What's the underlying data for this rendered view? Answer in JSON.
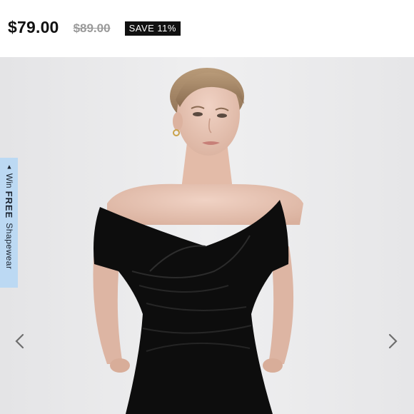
{
  "price": {
    "current": "$79.00",
    "original": "$89.00",
    "save_badge": "SAVE 11%"
  },
  "promo_tab": {
    "arrow": "▲",
    "win": "Win",
    "free": "FREE",
    "shapewear": "Shapewear"
  },
  "gallery": {
    "prev_icon": "chevron-left-icon",
    "next_icon": "chevron-right-icon"
  },
  "colors": {
    "price_text": "#111111",
    "strikethrough_price": "#9a9a9a",
    "badge_bg": "#111111",
    "badge_text": "#ffffff",
    "gallery_bg": "#e9e9ea",
    "promo_tab_bg": "#bcd9f3",
    "arrow_color": "#6e6e6e"
  }
}
